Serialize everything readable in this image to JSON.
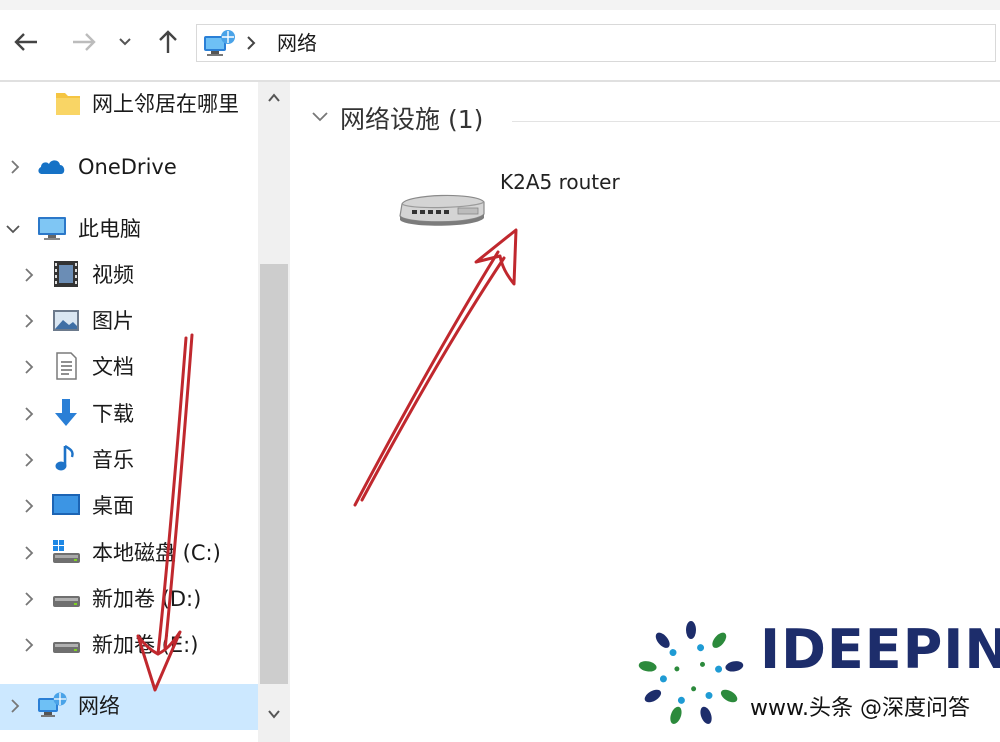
{
  "address_bar": {
    "path": "网络"
  },
  "sidebar": {
    "items": [
      {
        "label": "网上邻居在哪里",
        "icon": "folder-icon"
      },
      {
        "label": "OneDrive",
        "icon": "onedrive-cloud-icon"
      },
      {
        "label": "此电脑",
        "icon": "this-pc-icon"
      },
      {
        "label": "视频",
        "icon": "videos-folder-icon"
      },
      {
        "label": "图片",
        "icon": "pictures-folder-icon"
      },
      {
        "label": "文档",
        "icon": "documents-folder-icon"
      },
      {
        "label": "下载",
        "icon": "downloads-arrow-icon"
      },
      {
        "label": "音乐",
        "icon": "music-note-icon"
      },
      {
        "label": "桌面",
        "icon": "desktop-icon"
      },
      {
        "label": "本地磁盘 (C:)",
        "icon": "windows-drive-icon"
      },
      {
        "label": "新加卷 (D:)",
        "icon": "drive-icon"
      },
      {
        "label": "新加卷 (E:)",
        "icon": "drive-icon"
      },
      {
        "label": "网络",
        "icon": "network-icon"
      }
    ],
    "selected": "网络"
  },
  "content": {
    "group_title": "网络设施 (1)",
    "devices": [
      {
        "name": "K2A5 router",
        "icon": "router-icon"
      }
    ]
  },
  "watermark": {
    "brand": "IDEEPIN",
    "url": "www.头条 @深度问答"
  },
  "colors": {
    "selection": "#cce8ff",
    "arrow": "#c0282e",
    "brand": "#1d2d6b"
  }
}
